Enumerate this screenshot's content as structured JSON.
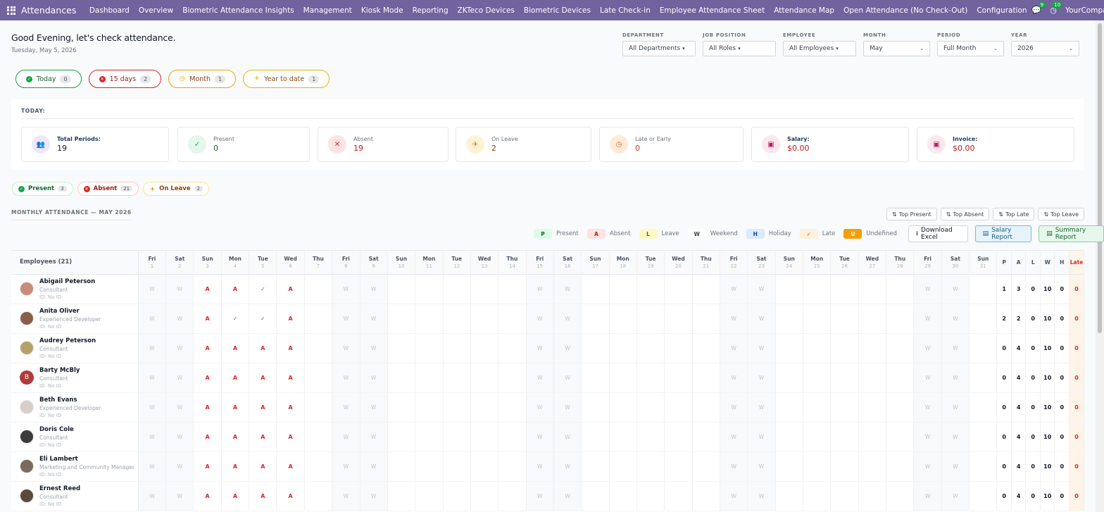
{
  "topbar": {
    "brand": "Attendances",
    "nav": [
      "Dashboard",
      "Overview",
      "Biometric Attendance Insights",
      "Management",
      "Kiosk Mode",
      "Reporting",
      "ZKTeco Devices",
      "Biometric Devices",
      "Late Check-in",
      "Employee Attendance Sheet",
      "Attendance Map",
      "Open Attendance (No Check-Out)",
      "Configuration"
    ],
    "messages_count": "9",
    "activity_count": "10",
    "company": "YourCompany"
  },
  "greeting": {
    "title": "Good Evening, let's check attendance.",
    "date": "Tuesday, May 5, 2026"
  },
  "filters": [
    {
      "label": "DEPARTMENT",
      "value": "All Departments",
      "kind": "dropdown"
    },
    {
      "label": "JOB POSITION",
      "value": "All Roles",
      "kind": "dropdown"
    },
    {
      "label": "EMPLOYEE",
      "value": "All Employees",
      "kind": "dropdown"
    },
    {
      "label": "MONTH",
      "value": "May",
      "kind": "select"
    },
    {
      "label": "PERIOD",
      "value": "Full Month",
      "kind": "select"
    },
    {
      "label": "YEAR",
      "value": "2026",
      "kind": "select"
    }
  ],
  "period_pills": [
    {
      "label": "Today",
      "count": "0",
      "color": "#16a34a"
    },
    {
      "label": "15 days",
      "count": "2",
      "color": "#dc2626"
    },
    {
      "label": "Month",
      "count": "1",
      "color": "#f59e0b"
    },
    {
      "label": "Year to date",
      "count": "1",
      "color": "#eab308"
    }
  ],
  "today": {
    "label": "TODAY:",
    "stats": [
      {
        "title": "Total Periods:",
        "value": "19",
        "bg": "#efe7fb",
        "fg": "#7c3aed",
        "icon": "users-icon",
        "vcolor": "#111827"
      },
      {
        "title": "Present",
        "value": "0",
        "bg": "#e5f6ea",
        "fg": "#16a34a",
        "icon": "check-circle-icon",
        "vcolor": "#166534"
      },
      {
        "title": "Absent",
        "value": "19",
        "bg": "#fde4e4",
        "fg": "#dc2626",
        "icon": "x-circle-icon",
        "vcolor": "#b91c1c"
      },
      {
        "title": "On Leave",
        "value": "2",
        "bg": "#fdf3d6",
        "fg": "#d97706",
        "icon": "plane-icon",
        "vcolor": "#92400e"
      },
      {
        "title": "Late or Early",
        "value": "0",
        "bg": "#fdebd9",
        "fg": "#ea580c",
        "icon": "clock-icon",
        "vcolor": "#c2410c"
      },
      {
        "title": "Salary:",
        "value": "$0.00",
        "bg": "#fce7ef",
        "fg": "#be185d",
        "icon": "money-icon",
        "vcolor": "#b91c1c"
      },
      {
        "title": "Invoice:",
        "value": "$0.00",
        "bg": "#fce7ef",
        "fg": "#be185d",
        "icon": "invoice-icon",
        "vcolor": "#b91c1c"
      }
    ]
  },
  "status_chips": [
    {
      "label": "Present",
      "count": "3"
    },
    {
      "label": "Absent",
      "count": "21"
    },
    {
      "label": "On Leave",
      "count": "2"
    }
  ],
  "monthly": {
    "title": "MONTHLY ATTENDANCE — MAY 2026",
    "sort_buttons": [
      "Top Present",
      "Top Absent",
      "Top Late",
      "Top Leave"
    ],
    "legend": [
      {
        "code": "P",
        "label": "Present",
        "bg": "#dcfce7",
        "fg": "#166534"
      },
      {
        "code": "A",
        "label": "Absent",
        "bg": "#fee2e2",
        "fg": "#b91c1c"
      },
      {
        "code": "L",
        "label": "Leave",
        "bg": "#fef9c3",
        "fg": "#854d0e"
      },
      {
        "code": "W",
        "label": "Weekend",
        "bg": "#ffffff",
        "fg": "#374151"
      },
      {
        "code": "H",
        "label": "Holiday",
        "bg": "#dbeafe",
        "fg": "#1e40af"
      },
      {
        "code": "✓",
        "label": "Late",
        "bg": "#fdf0dd",
        "fg": "#b45309"
      },
      {
        "code": "U",
        "label": "Undefined",
        "bg": "#f59e0b",
        "fg": "#ffffff"
      }
    ],
    "actions": {
      "download": "Download Excel",
      "salary": "Salary Report",
      "summary": "Summary Report"
    },
    "employees_header": "Employees (21)",
    "days": [
      [
        "Fri",
        "1"
      ],
      [
        "Sat",
        "2"
      ],
      [
        "Sun",
        "3"
      ],
      [
        "Mon",
        "4"
      ],
      [
        "Tue",
        "5"
      ],
      [
        "Wed",
        "6"
      ],
      [
        "Thu",
        "7"
      ],
      [
        "Fri",
        "8"
      ],
      [
        "Sat",
        "9"
      ],
      [
        "Sun",
        "10"
      ],
      [
        "Mon",
        "11"
      ],
      [
        "Tue",
        "12"
      ],
      [
        "Wed",
        "13"
      ],
      [
        "Thu",
        "14"
      ],
      [
        "Fri",
        "15"
      ],
      [
        "Sat",
        "16"
      ],
      [
        "Sun",
        "17"
      ],
      [
        "Mon",
        "18"
      ],
      [
        "Tue",
        "19"
      ],
      [
        "Wed",
        "20"
      ],
      [
        "Thu",
        "21"
      ],
      [
        "Fri",
        "22"
      ],
      [
        "Sat",
        "23"
      ],
      [
        "Sun",
        "24"
      ],
      [
        "Mon",
        "25"
      ],
      [
        "Tue",
        "26"
      ],
      [
        "Wed",
        "27"
      ],
      [
        "Thu",
        "28"
      ],
      [
        "Fri",
        "29"
      ],
      [
        "Sat",
        "30"
      ],
      [
        "Sun",
        "31"
      ]
    ],
    "weekend_days": [
      1,
      2,
      8,
      9,
      15,
      16,
      22,
      23,
      29,
      30
    ],
    "totals_headers": [
      "P",
      "A",
      "L",
      "W",
      "H",
      "Late"
    ],
    "employees": [
      {
        "name": "Abigail Peterson",
        "role": "Consultant",
        "id": "ID: No ID",
        "initial": "",
        "av": "#c98a7a",
        "cells": {
          "3": "A",
          "4": "A",
          "5": "✓",
          "6": "A"
        },
        "totals": [
          "1",
          "3",
          "0",
          "10",
          "0",
          "0"
        ]
      },
      {
        "name": "Anita Oliver",
        "role": "Experienced Developer",
        "id": "ID: No ID",
        "initial": "",
        "av": "#8b5e4a",
        "cells": {
          "3": "A",
          "4": "✓",
          "5": "✓",
          "6": "A"
        },
        "totals": [
          "2",
          "2",
          "0",
          "10",
          "0",
          "0"
        ]
      },
      {
        "name": "Audrey Peterson",
        "role": "Consultant",
        "id": "ID: No ID",
        "initial": "",
        "av": "#b9a06a",
        "cells": {
          "3": "A",
          "4": "A",
          "5": "A",
          "6": "A"
        },
        "totals": [
          "0",
          "4",
          "0",
          "10",
          "0",
          "0"
        ]
      },
      {
        "name": "Barty McBly",
        "role": "Consultant",
        "id": "ID: No ID",
        "initial": "B",
        "av": "#b23b3b",
        "cells": {
          "3": "A",
          "4": "A",
          "5": "A",
          "6": "A"
        },
        "totals": [
          "0",
          "4",
          "0",
          "10",
          "0",
          "0"
        ]
      },
      {
        "name": "Beth Evans",
        "role": "Experienced Developer",
        "id": "ID: No ID",
        "initial": "",
        "av": "#d9cfc9",
        "cells": {
          "3": "A",
          "4": "A",
          "5": "A",
          "6": "A"
        },
        "totals": [
          "0",
          "4",
          "0",
          "10",
          "0",
          "0"
        ]
      },
      {
        "name": "Doris Cole",
        "role": "Consultant",
        "id": "ID: No ID",
        "initial": "",
        "av": "#3b3b3b",
        "cells": {
          "3": "A",
          "4": "A",
          "5": "A",
          "6": "A"
        },
        "totals": [
          "0",
          "4",
          "0",
          "10",
          "0",
          "0"
        ]
      },
      {
        "name": "Eli Lambert",
        "role": "Marketing and Community Manager",
        "id": "ID: No ID",
        "initial": "",
        "av": "#7a6a5a",
        "cells": {
          "3": "A",
          "4": "A",
          "5": "A",
          "6": "A"
        },
        "totals": [
          "0",
          "4",
          "0",
          "10",
          "0",
          "0"
        ]
      },
      {
        "name": "Ernest Reed",
        "role": "Consultant",
        "id": "ID: No ID",
        "initial": "",
        "av": "#5a4a3a",
        "cells": {
          "3": "A",
          "4": "A",
          "5": "A",
          "6": "A"
        },
        "totals": [
          "0",
          "4",
          "0",
          "10",
          "0",
          "0"
        ]
      }
    ]
  }
}
